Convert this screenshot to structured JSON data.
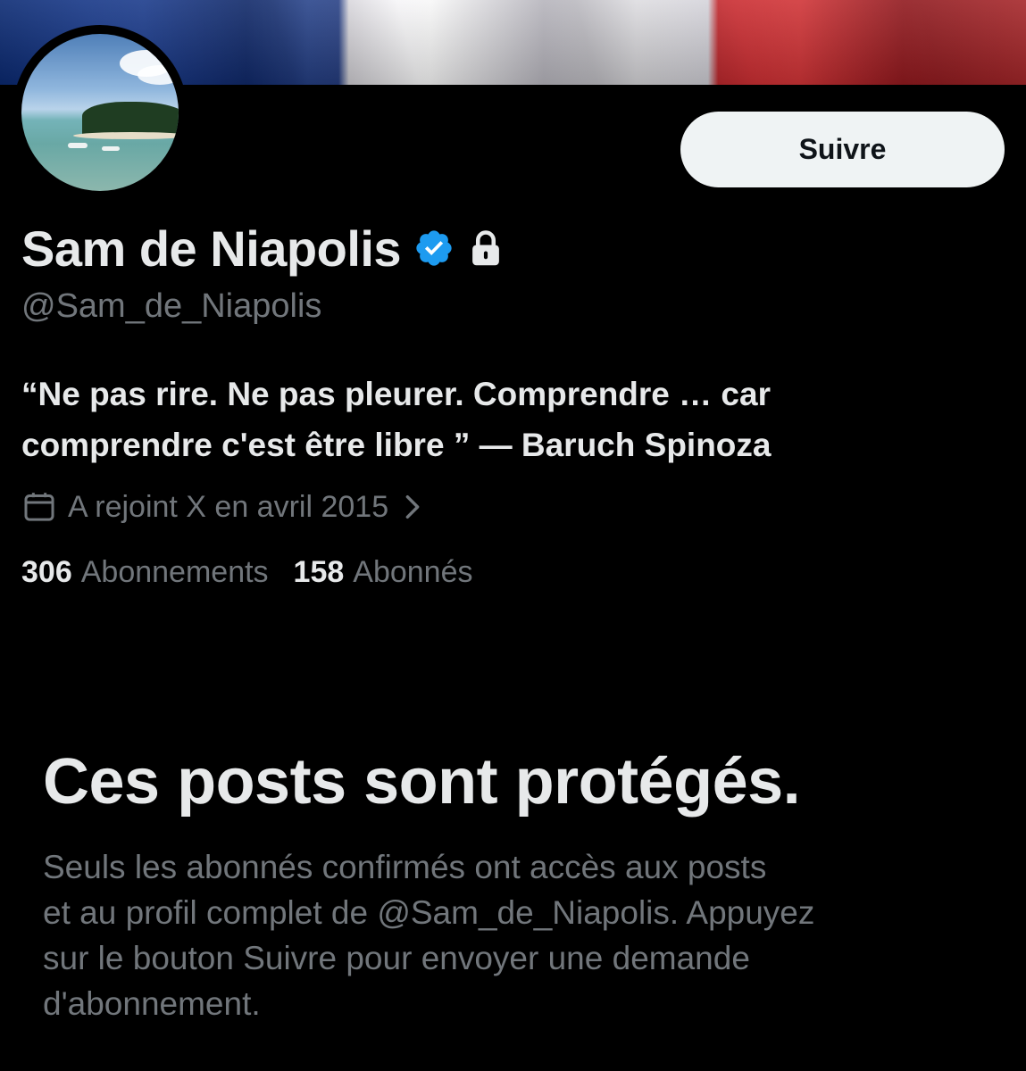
{
  "profile": {
    "display_name": "Sam de Niapolis",
    "handle": "@Sam_de_Niapolis",
    "bio_line1": "“Ne pas rire. Ne pas pleurer. Comprendre … car",
    "bio_line2": "comprendre c'est être libre ” — Baruch Spinoza",
    "joined": "A rejoint X en avril 2015",
    "following_count": "306",
    "following_label": "Abonnements",
    "followers_count": "158",
    "followers_label": "Abonnés",
    "verified_icon": "verified-badge-icon",
    "lock_icon": "lock-icon",
    "calendar_icon": "calendar-icon",
    "chevron_icon": "chevron-right-icon"
  },
  "actions": {
    "follow_label": "Suivre"
  },
  "protected": {
    "title": "Ces posts sont protégés.",
    "line1": "Seuls les abonnés confirmés ont accès aux posts",
    "line2": "et au profil complet de @Sam_de_Niapolis. Appuyez",
    "line3": "sur le bouton Suivre pour envoyer une demande",
    "line4": "d'abonnement."
  },
  "colors": {
    "background": "#000000",
    "primary_text": "#e7e9ea",
    "secondary_text": "#71767b",
    "verified_blue": "#1d9bf0",
    "button_bg": "#eff3f4"
  }
}
